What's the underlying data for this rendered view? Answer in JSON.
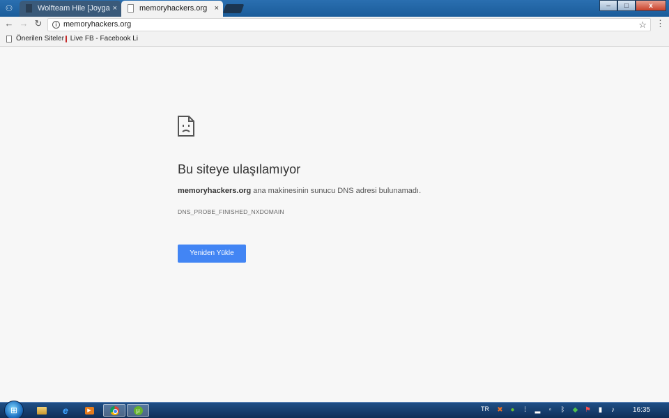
{
  "browser": {
    "tabs": [
      {
        "label": "Wolfteam Hile [Joygame",
        "close": "×",
        "active": false
      },
      {
        "label": "memoryhackers.org",
        "close": "×",
        "active": true
      }
    ],
    "window_controls": {
      "minimize": "–",
      "maximize": "□",
      "close": "x"
    },
    "address_bar": {
      "url": "memoryhackers.org",
      "info_icon": "i"
    },
    "bookmarks": [
      {
        "label": "Önerilen Siteler",
        "icon": "page-icon"
      },
      {
        "label": "Live FB - Facebook Li",
        "icon": "facebook-live-icon"
      }
    ]
  },
  "error_page": {
    "title": "Bu siteye ulaşılamıyor",
    "host": "memoryhackers.org",
    "message": " ana makinesinin sunucu DNS adresi bulunamadı.",
    "code": "DNS_PROBE_FINISHED_NXDOMAIN",
    "reload_label": "Yeniden Yükle"
  },
  "taskbar": {
    "language": "TR",
    "clock": "16:35",
    "pinned": [
      "folder-icon",
      "internet-explorer-icon",
      "media-player-icon",
      "chrome-icon",
      "utorrent-icon"
    ]
  },
  "colors": {
    "accent_button": "#4285f4",
    "page_background": "#f7f7f7",
    "titlebar": "#1a5c9a"
  }
}
